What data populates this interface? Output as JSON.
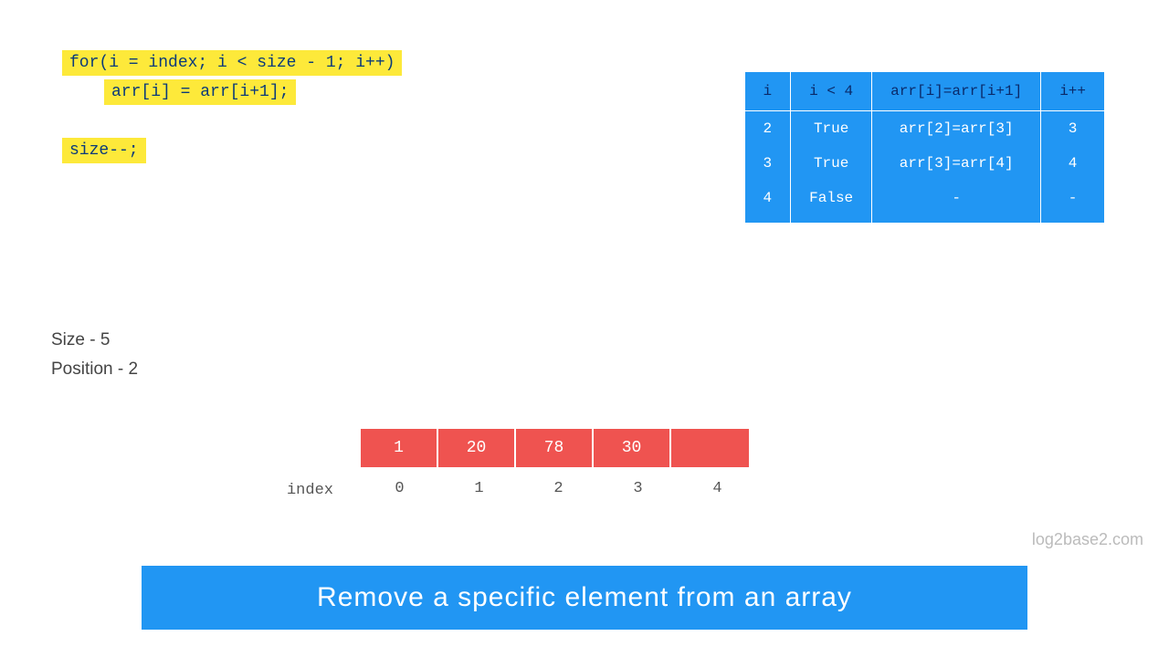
{
  "code": {
    "line1": "for(i = index; i < size - 1; i++)",
    "line2": "arr[i] = arr[i+1];",
    "line3": "size--;"
  },
  "trace": {
    "headers": [
      "i",
      "i < 4",
      "arr[i]=arr[i+1]",
      "i++"
    ],
    "rows": [
      [
        "2",
        "True",
        "arr[2]=arr[3]",
        "3"
      ],
      [
        "3",
        "True",
        "arr[3]=arr[4]",
        "4"
      ],
      [
        "4",
        "False",
        "-",
        "-"
      ]
    ]
  },
  "info": {
    "size": "Size - 5",
    "position": "Position - 2"
  },
  "array": {
    "label": "index",
    "values": [
      "1",
      "20",
      "78",
      "30",
      ""
    ],
    "indices": [
      "0",
      "1",
      "2",
      "3",
      "4"
    ]
  },
  "watermark": "log2base2.com",
  "title": "Remove a specific element from an array"
}
